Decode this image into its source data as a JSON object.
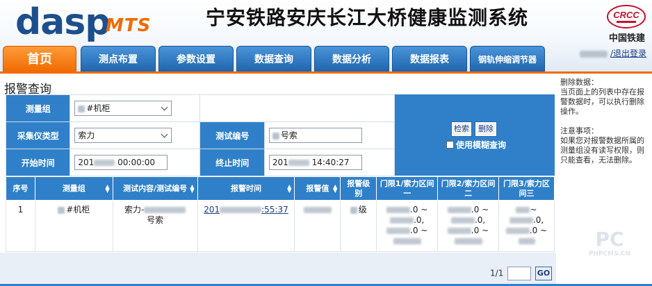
{
  "header": {
    "logo_main": "dasp",
    "logo_sub": "MTS",
    "system_title": "宁安铁路安庆长江大桥健康监测系统",
    "brand_text": "中国铁建",
    "brand_logo_letters": "CRCC",
    "logout_label": "/退出登录"
  },
  "tabs": [
    {
      "label": "首页",
      "active": true
    },
    {
      "label": "测点布置"
    },
    {
      "label": "参数设置"
    },
    {
      "label": "数据查询"
    },
    {
      "label": "数据分析"
    },
    {
      "label": "数据报表"
    },
    {
      "label": "钢轨伸缩调节器"
    }
  ],
  "page": {
    "title": "报警查询"
  },
  "form": {
    "measure_group_label": "测量组",
    "measure_group_value": "#机柜",
    "collector_type_label": "采集仪类型",
    "collector_type_value": "索力",
    "test_no_label": "测试编号",
    "test_no_value": "号索",
    "start_time_label": "开始时间",
    "start_time_value": "00:00:00",
    "start_time_prefix": "201",
    "end_time_label": "终止时间",
    "end_time_value": "14:40:27",
    "end_time_prefix": "201",
    "search_button": "检索",
    "delete_button": "删除",
    "fuzzy_label": "使用模糊查询"
  },
  "notes": {
    "delete_title": "删除数据：",
    "delete_text": "当页面上的列表中存在报警数据时，可以执行删除操作。",
    "attention_title": "注意事项：",
    "attention_text": "如果您对报警数据所属的测量组没有读写权限，则只能查看，无法删除。"
  },
  "table": {
    "headers": [
      "序号",
      "测量组",
      "测试内容/测试编号",
      "报警时间",
      "报警值",
      "报警级别",
      "门限1/索力区间一",
      "门限2/索力区间二",
      "门限3/索力区间三"
    ],
    "rows": [
      {
        "index": "1",
        "group": "#机柜",
        "content_prefix": "索力-",
        "content_suffix": "号索",
        "time_prefix": "201",
        "time_suffix": ":55:37",
        "level": "级",
        "t1a": ".0 ~",
        "t1b": ".0,",
        "t1c": ".0 ~",
        "t2a": ".0 ~",
        "t2b": ".0,",
        "t2c": ".0 ~",
        "t3a": "~",
        "t3b": ".0,",
        "t3c": ".0 ~"
      }
    ]
  },
  "pager": {
    "text": "1/1",
    "go_label": "GO"
  },
  "watermark": {
    "main": "PC",
    "sub": "PHPCMS.CN"
  },
  "colors": {
    "tab_blue": "#2f80c9",
    "tab_active_orange": "#f06a00",
    "logo_blue": "#1d4f8c"
  }
}
